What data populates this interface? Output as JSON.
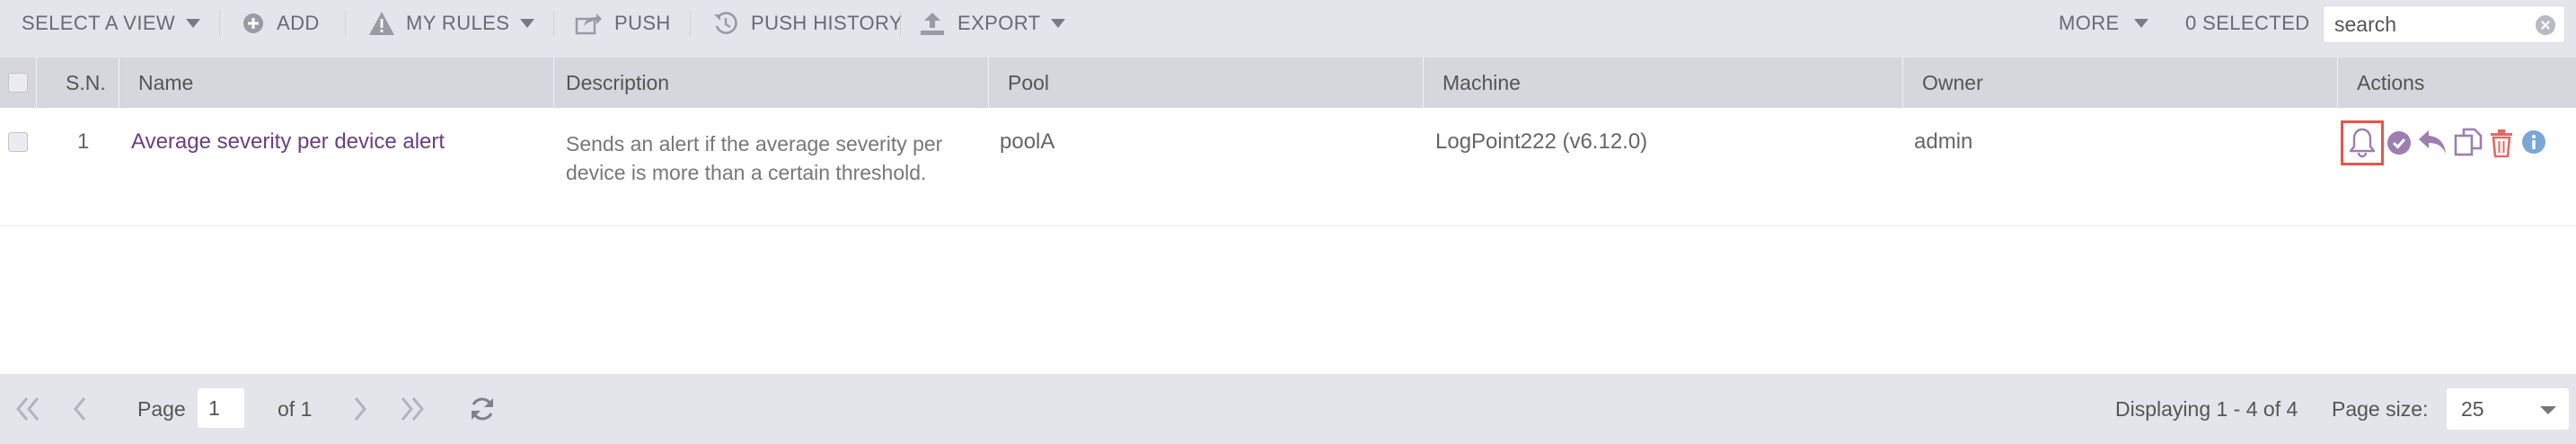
{
  "toolbar": {
    "select_view": "SELECT A VIEW",
    "add": "ADD",
    "my_rules": "MY RULES",
    "push": "PUSH",
    "push_history": "PUSH HISTORY",
    "export": "EXPORT",
    "more": "MORE",
    "selected": "0 SELECTED",
    "search_placeholder": "search"
  },
  "columns": [
    "S.N.",
    "Name",
    "Description",
    "Pool",
    "Machine",
    "Owner",
    "Actions"
  ],
  "rows": [
    {
      "sn": "1",
      "name": "Average severity per device alert",
      "description": "Sends an alert if the average severity per device is more than a certain threshold.",
      "pool": "poolA",
      "machine": "LogPoint222 (v6.12.0)",
      "owner": "admin",
      "actions": [
        "bell-icon",
        "check-circle-icon",
        "reply-icon",
        "copy-icon",
        "trash-icon",
        "info-icon"
      ]
    }
  ],
  "pager": {
    "page_label": "Page",
    "page_value": "1",
    "of_label": "of 1",
    "displaying": "Displaying 1 - 4 of 4",
    "page_size_label": "Page size:",
    "page_size_value": "25"
  },
  "colors": {
    "toolbar_bg": "#e4e5ea",
    "header_bg": "#d6d7dd",
    "name_link": "#6b3f7e",
    "action_purple": "#9b7fb0",
    "action_delete": "#e06a6a",
    "action_info": "#7aa8d6",
    "highlight": "#e8554a"
  }
}
